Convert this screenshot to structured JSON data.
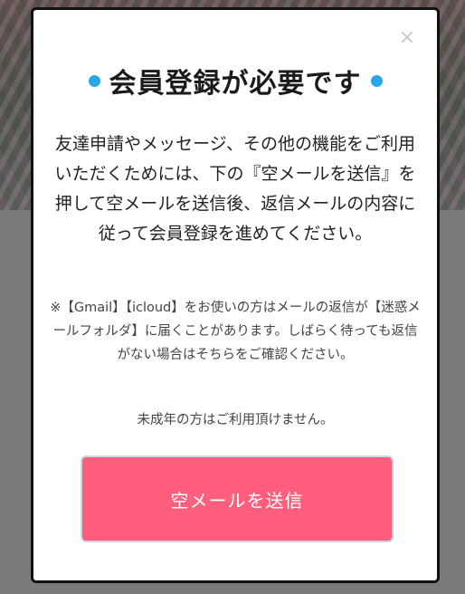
{
  "modal": {
    "close_symbol": "×",
    "title": "会員登録が必要です",
    "title_dot_color": "#2aa6e6",
    "body": "友達申請やメッセージ、その他の機能をご利用いただくためには、下の『空メールを送信』を押して空メールを送信後、返信メールの内容に従って会員登録を進めてください。",
    "note": "※【Gmail】【icloud】をお使いの方はメールの返信が【迷惑メールフォルダ】に届くことがあります。しばらく待っても返信がない場合はそちらをご確認ください。",
    "note_age": "未成年の方はご利用頂けません。",
    "button_label": "空メールを送信",
    "button_color": "#ff5f7d"
  }
}
